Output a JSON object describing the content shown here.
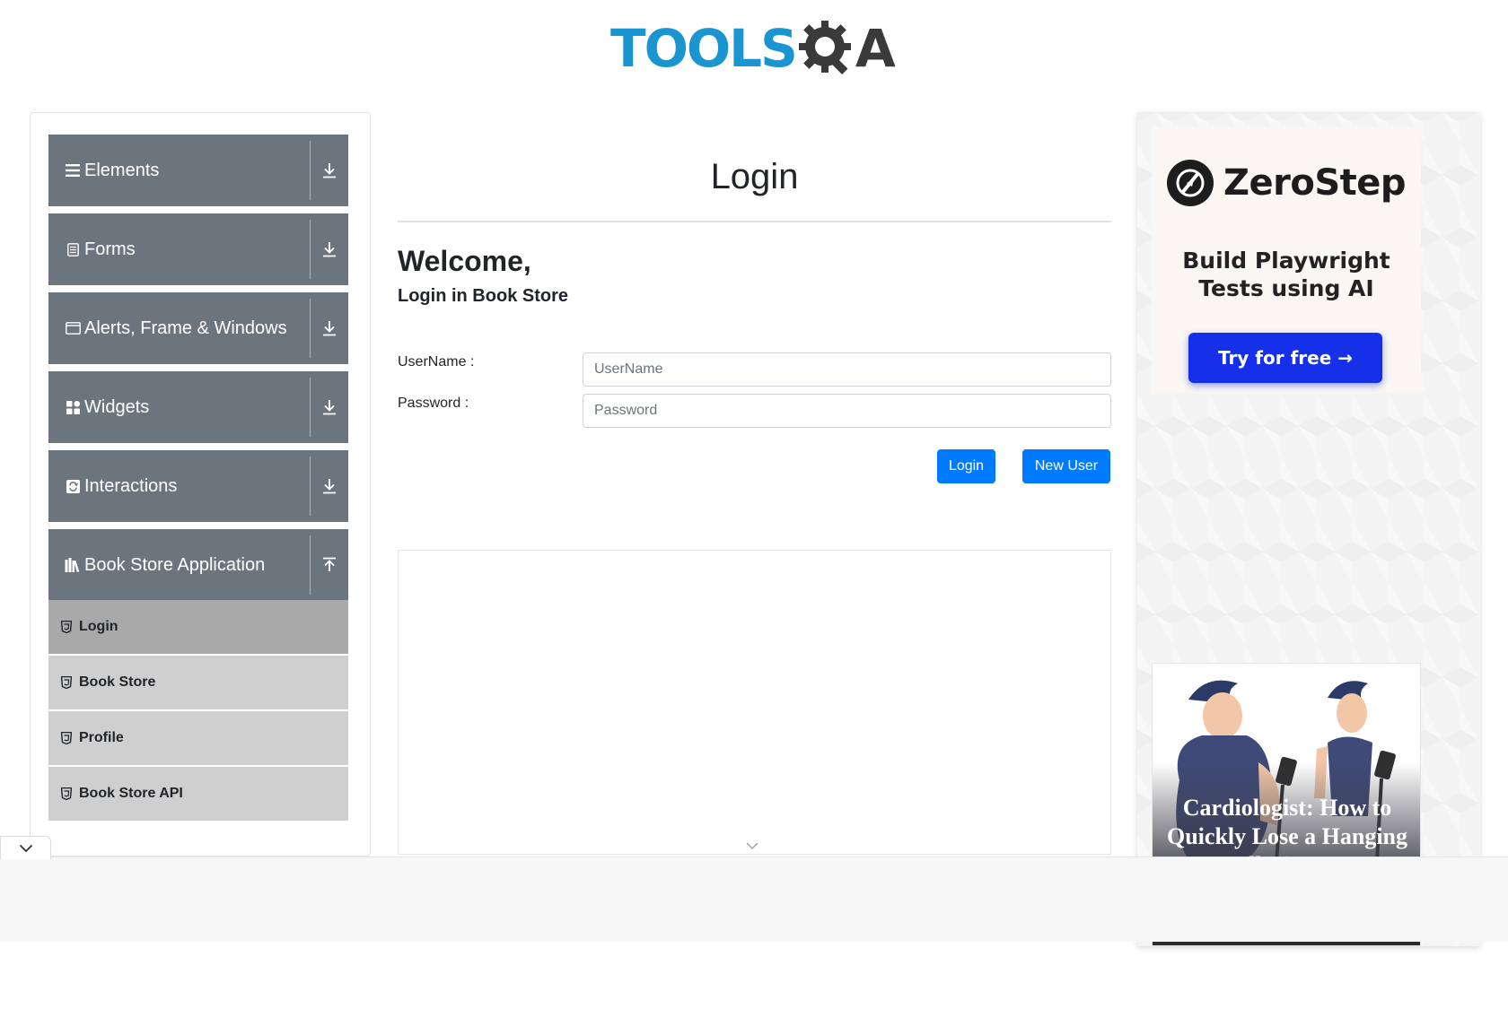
{
  "brand": {
    "logo_tools": "TOOLS",
    "logo_a": "A",
    "colors": {
      "tools_blue": "#1a95d0",
      "dark": "#3a3a3a"
    }
  },
  "sidebar": {
    "groups": [
      {
        "label": "Elements",
        "icon": "hamburger-icon",
        "toggle": "download-arrow-icon"
      },
      {
        "label": "Forms",
        "icon": "document-icon",
        "toggle": "download-arrow-icon"
      },
      {
        "label": "Alerts, Frame & Windows",
        "icon": "window-icon",
        "toggle": "download-arrow-icon"
      },
      {
        "label": "Widgets",
        "icon": "widgets-icon",
        "toggle": "download-arrow-icon"
      },
      {
        "label": "Interactions",
        "icon": "refresh-icon",
        "toggle": "download-arrow-icon"
      },
      {
        "label": "Book Store Application",
        "icon": "books-icon",
        "toggle": "upload-arrow-icon"
      }
    ],
    "submenu": [
      {
        "label": "Login",
        "icon": "html5-icon",
        "active": true
      },
      {
        "label": "Book Store",
        "icon": "html5-icon",
        "active": false
      },
      {
        "label": "Profile",
        "icon": "html5-icon",
        "active": false
      },
      {
        "label": "Book Store API",
        "icon": "html5-icon",
        "active": false
      }
    ],
    "colors": {
      "group_bg": "#6c757d",
      "sub_bg": "#cfcfcf",
      "sub_active_bg": "#a9a9a9"
    }
  },
  "main": {
    "title": "Login",
    "welcome": "Welcome,",
    "subtitle": "Login in Book Store",
    "username": {
      "label": "UserName :",
      "placeholder": "UserName",
      "value": ""
    },
    "password": {
      "label": "Password :",
      "placeholder": "Password",
      "value": ""
    },
    "login_button": "Login",
    "new_user_button": "New User",
    "colors": {
      "primary": "#007bff"
    }
  },
  "ads": {
    "zerostep": {
      "brand": "ZeroStep",
      "tagline_line1": "Build Playwright",
      "tagline_line2": "Tests using AI",
      "cta": "Try for free →",
      "colors": {
        "cta_bg": "#1530e8"
      }
    },
    "health": {
      "caption": "Cardiologist: How to Quickly Lose a Hanging Belly (Here's"
    }
  },
  "bottom": {
    "collapse_icon": "chevron-down-icon"
  }
}
